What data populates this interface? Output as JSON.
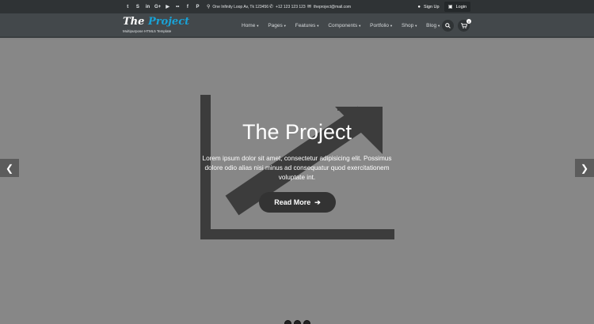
{
  "topbar": {
    "social_icons": [
      "twitter-icon",
      "skype-icon",
      "linkedin-icon",
      "google-plus-icon",
      "youtube-icon",
      "flickr-icon",
      "facebook-icon",
      "pinterest-icon"
    ],
    "social_glyphs": [
      "t",
      "S",
      "in",
      "G+",
      "▶",
      "••",
      "f",
      "P"
    ],
    "address": "One Infinity Loop Av, Tk 123456",
    "phone": "+12 123 123 123",
    "email": "theproject@mail.com",
    "signup_label": "Sign Up",
    "login_label": "Login"
  },
  "header": {
    "logo_prefix": "The",
    "logo_accent": "Project",
    "tagline": "Multipurpose HTML5 Template",
    "nav": [
      {
        "label": "Home"
      },
      {
        "label": "Pages"
      },
      {
        "label": "Features"
      },
      {
        "label": "Components"
      },
      {
        "label": "Portfolio"
      },
      {
        "label": "Shop"
      },
      {
        "label": "Blog"
      }
    ],
    "cart_count": "0"
  },
  "hero": {
    "title": "The Project",
    "text": "Lorem ipsum dolor sit amet, consectetur adipisicing elit. Possimus dolore odio alias nisi minus ad consequatur quod exercitationem voluptate int.",
    "button_label": "Read More"
  },
  "colors": {
    "accent": "#19a2d6",
    "topbar": "#2f3335",
    "header": "#43484b",
    "hero": "#878787"
  }
}
